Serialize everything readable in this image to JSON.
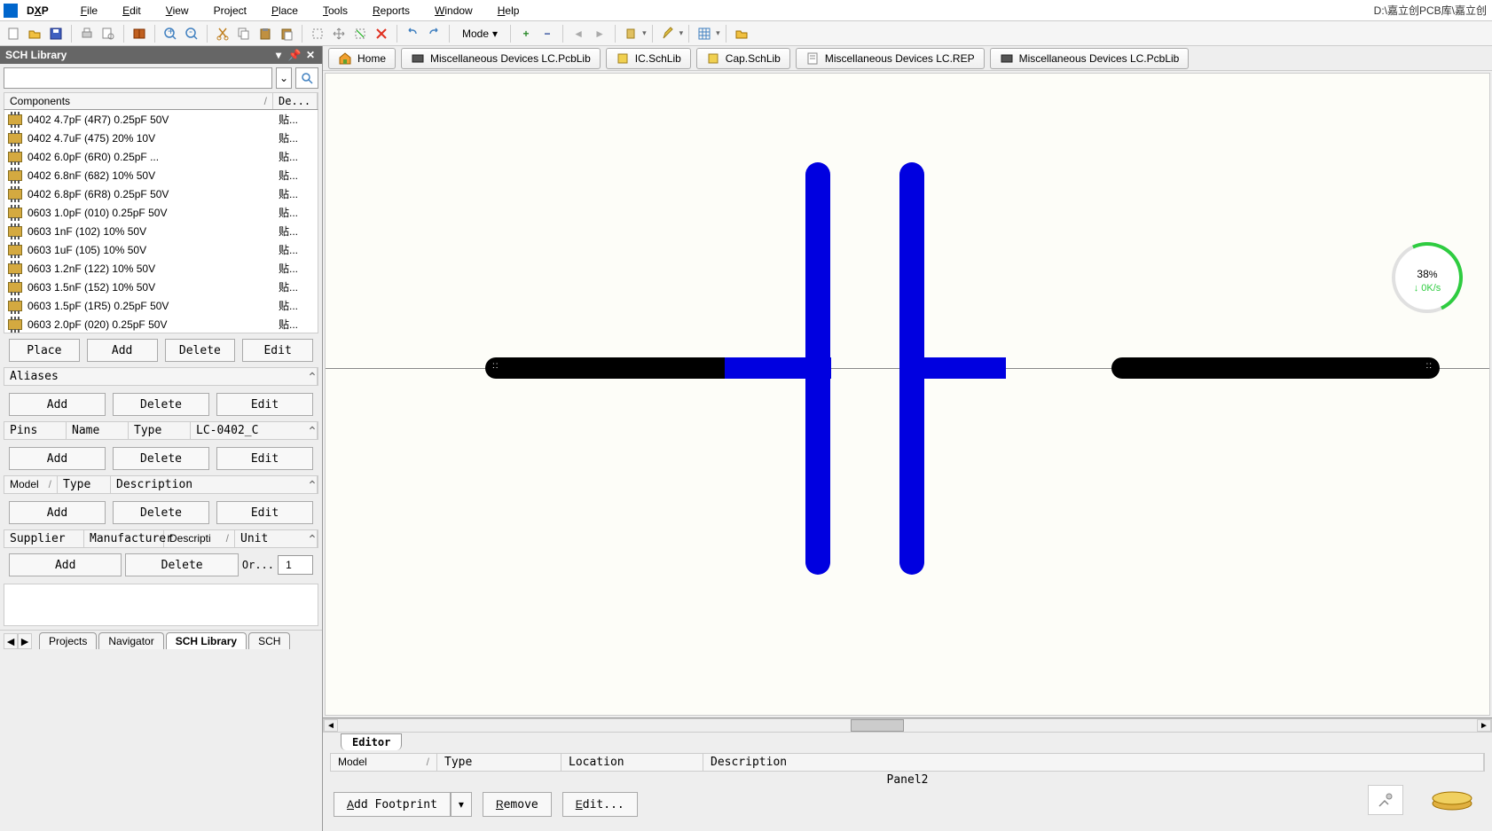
{
  "title_path": "D:\\嘉立创PCB库\\嘉立创",
  "app_name": "DXP",
  "menu": {
    "file": "File",
    "edit": "Edit",
    "view": "View",
    "project": "Project",
    "place": "Place",
    "tools": "Tools",
    "reports": "Reports",
    "window": "Window",
    "help": "Help"
  },
  "toolbar": {
    "mode_label": "Mode"
  },
  "left_panel": {
    "title": "SCH Library",
    "search_value": "",
    "components_header": {
      "col1": "Components",
      "col2": "De..."
    },
    "components": [
      {
        "name": "0402 4.7pF (4R7) 0.25pF 50V",
        "desc": "贴..."
      },
      {
        "name": "0402 4.7uF (475) 20% 10V",
        "desc": "贴..."
      },
      {
        "name": "0402 6.0pF (6R0) 0.25pF ...",
        "desc": "贴..."
      },
      {
        "name": "0402 6.8nF (682) 10% 50V",
        "desc": "贴..."
      },
      {
        "name": "0402 6.8pF (6R8) 0.25pF 50V",
        "desc": "贴..."
      },
      {
        "name": "0603 1.0pF (010) 0.25pF 50V",
        "desc": "贴..."
      },
      {
        "name": "0603 1nF (102) 10% 50V",
        "desc": "贴..."
      },
      {
        "name": "0603 1uF (105) 10% 50V",
        "desc": "贴..."
      },
      {
        "name": "0603 1.2nF (122) 10% 50V",
        "desc": "贴..."
      },
      {
        "name": "0603 1.5nF (152) 10% 50V",
        "desc": "贴..."
      },
      {
        "name": "0603 1.5pF (1R5) 0.25pF 50V",
        "desc": "贴..."
      },
      {
        "name": "0603 2.0pF (020) 0.25pF 50V",
        "desc": "贴..."
      }
    ],
    "buttons": {
      "place": "Place",
      "add": "Add",
      "delete": "Delete",
      "edit": "Edit"
    },
    "aliases": {
      "header": "Aliases",
      "add": "Add",
      "delete": "Delete",
      "edit": "Edit"
    },
    "pins": {
      "pins": "Pins",
      "name": "Name",
      "type": "Type",
      "value": "LC-0402_C",
      "add": "Add",
      "delete": "Delete",
      "edit": "Edit"
    },
    "model": {
      "model": "Model",
      "type": "Type",
      "description": "Description",
      "add": "Add",
      "delete": "Delete",
      "edit": "Edit"
    },
    "supplier": {
      "supplier": "Supplier",
      "manufacturer": "Manufacturer",
      "descripti": "Descripti",
      "unit": "Unit",
      "add": "Add",
      "delete": "Delete",
      "or": "Or...",
      "qty": "1"
    },
    "bottom_tabs": {
      "projects": "Projects",
      "navigator": "Navigator",
      "sch_library": "SCH Library",
      "sch": "SCH"
    }
  },
  "doc_tabs": {
    "home": "Home",
    "pcblib1": "Miscellaneous Devices LC.PcbLib",
    "icschlib": "IC.SchLib",
    "capschlib": "Cap.SchLib",
    "rep": "Miscellaneous Devices LC.REP",
    "pcblib2": "Miscellaneous Devices LC.PcbLib"
  },
  "speed_widget": {
    "percent": "38",
    "percent_suffix": "%",
    "rate": "↓ 0K/s"
  },
  "bottom_editor": {
    "tab": "Editor",
    "cols": {
      "model": "Model",
      "type": "Type",
      "location": "Location",
      "description": "Description"
    },
    "panel_label": "Panel2",
    "add_footprint": "Add Footprint",
    "remove": "Remove",
    "edit": "Edit..."
  }
}
